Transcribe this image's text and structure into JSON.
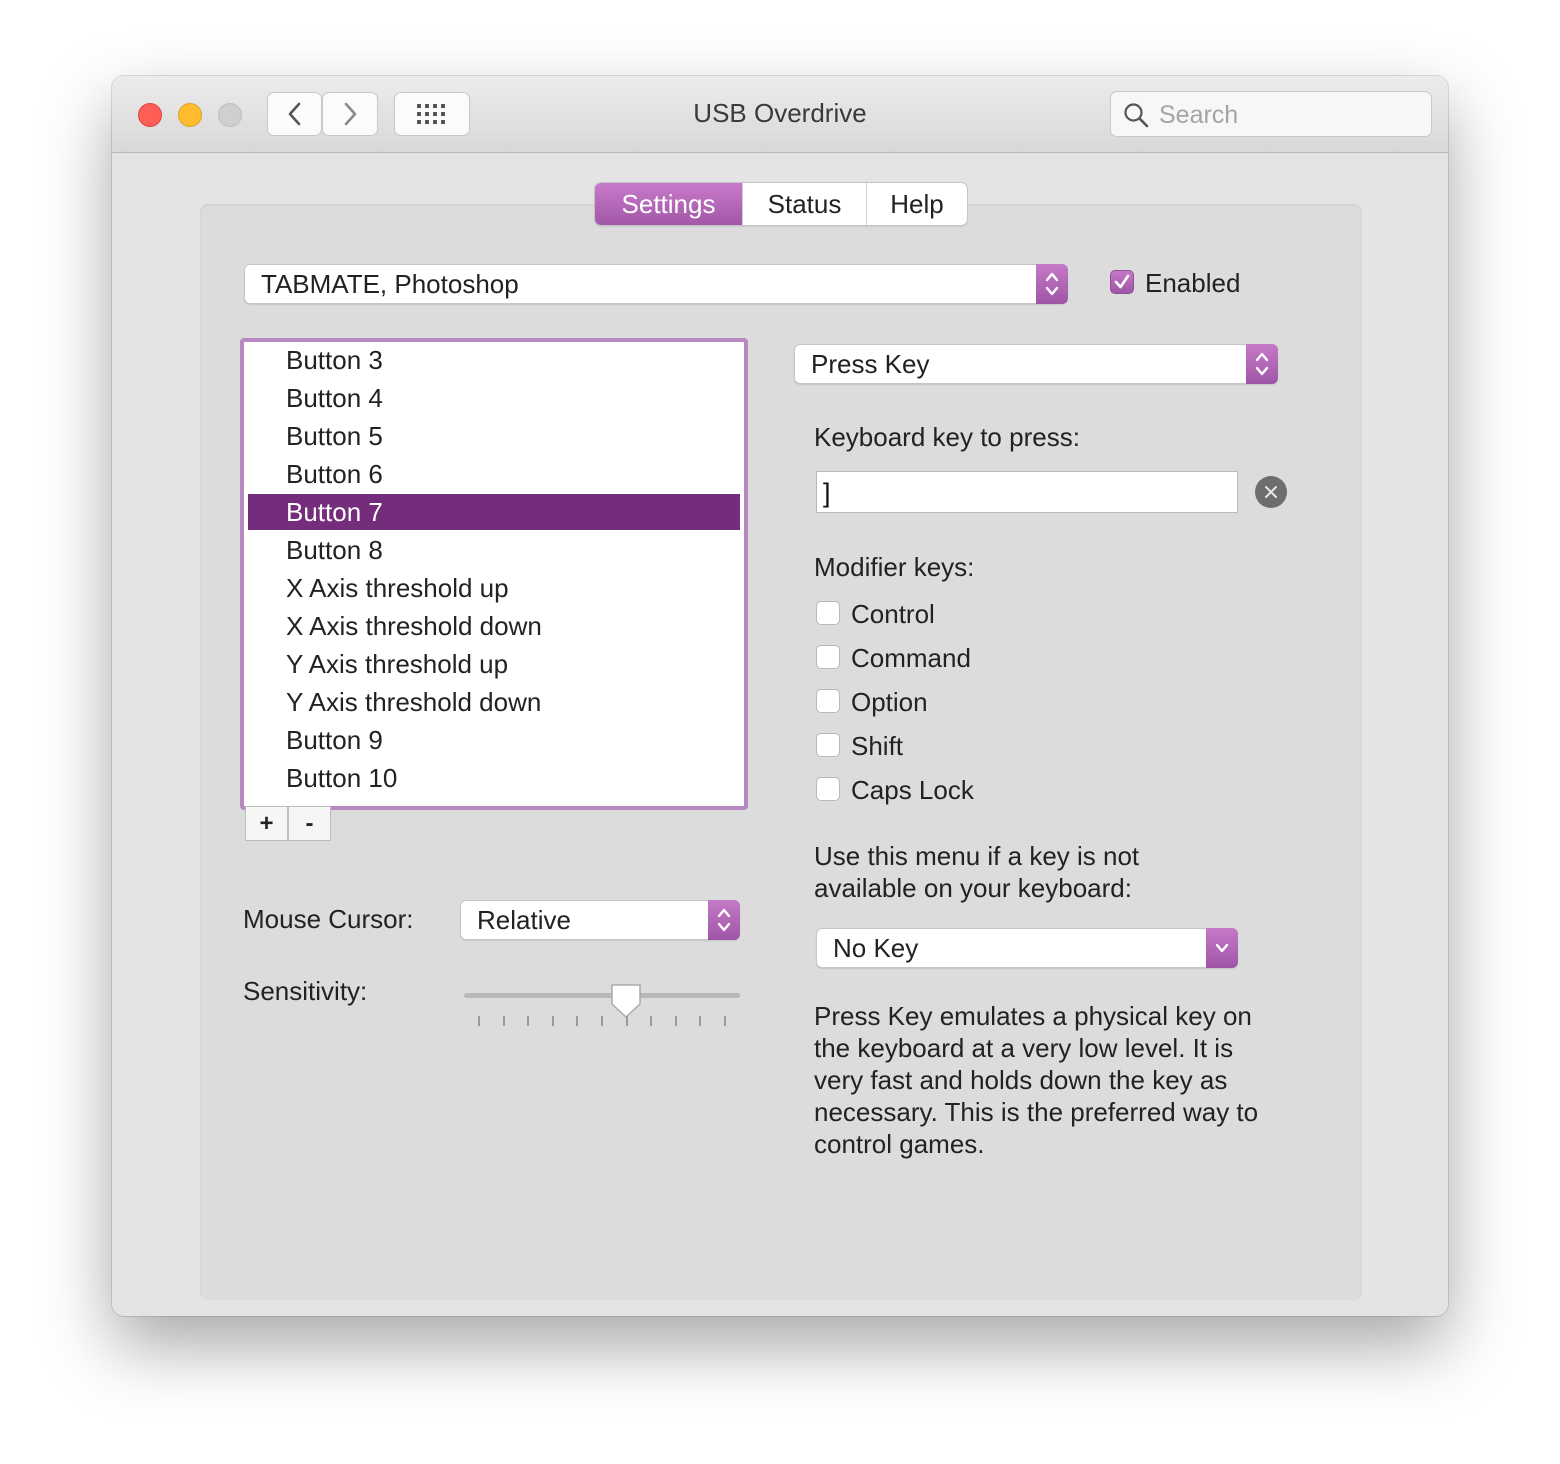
{
  "window": {
    "title": "USB Overdrive",
    "search_placeholder": "Search"
  },
  "tabs": [
    {
      "label": "Settings",
      "active": true
    },
    {
      "label": "Status",
      "active": false
    },
    {
      "label": "Help",
      "active": false
    }
  ],
  "device": {
    "selected": "TABMATE, Photoshop",
    "enabled_label": "Enabled",
    "enabled": true
  },
  "buttons_list": {
    "items": [
      "Button 3",
      "Button 4",
      "Button 5",
      "Button 6",
      "Button 7",
      "Button 8",
      "X Axis threshold up",
      "X Axis threshold down",
      "Y Axis threshold up",
      "Y Axis threshold down",
      "Button 9",
      "Button 10"
    ],
    "selected_index": 4,
    "add_label": "+",
    "remove_label": "-"
  },
  "mouse": {
    "cursor_label": "Mouse Cursor:",
    "cursor_value": "Relative",
    "sensitivity_label": "Sensitivity:",
    "sensitivity_level": 0.6,
    "tick_count": 11
  },
  "action": {
    "selected": "Press Key",
    "key_label": "Keyboard key to press:",
    "key_value": "]",
    "modifier_label": "Modifier keys:",
    "modifiers": [
      {
        "label": "Control",
        "checked": false
      },
      {
        "label": "Command",
        "checked": false
      },
      {
        "label": "Option",
        "checked": false
      },
      {
        "label": "Shift",
        "checked": false
      },
      {
        "label": "Caps Lock",
        "checked": false
      }
    ],
    "menu_hint_line1": "Use this menu if a key is not",
    "menu_hint_line2": "available on your keyboard:",
    "no_key_value": "No Key",
    "description_lines": [
      "Press Key emulates a physical key on",
      "the keyboard at a very low level. It is",
      "very fast and holds down the key as",
      "necessary. This is the preferred way to",
      "control games."
    ]
  },
  "colors": {
    "accent": "#a257a7",
    "selection": "#742d7a",
    "close": "#fd5f57",
    "minimize": "#febc2e"
  }
}
